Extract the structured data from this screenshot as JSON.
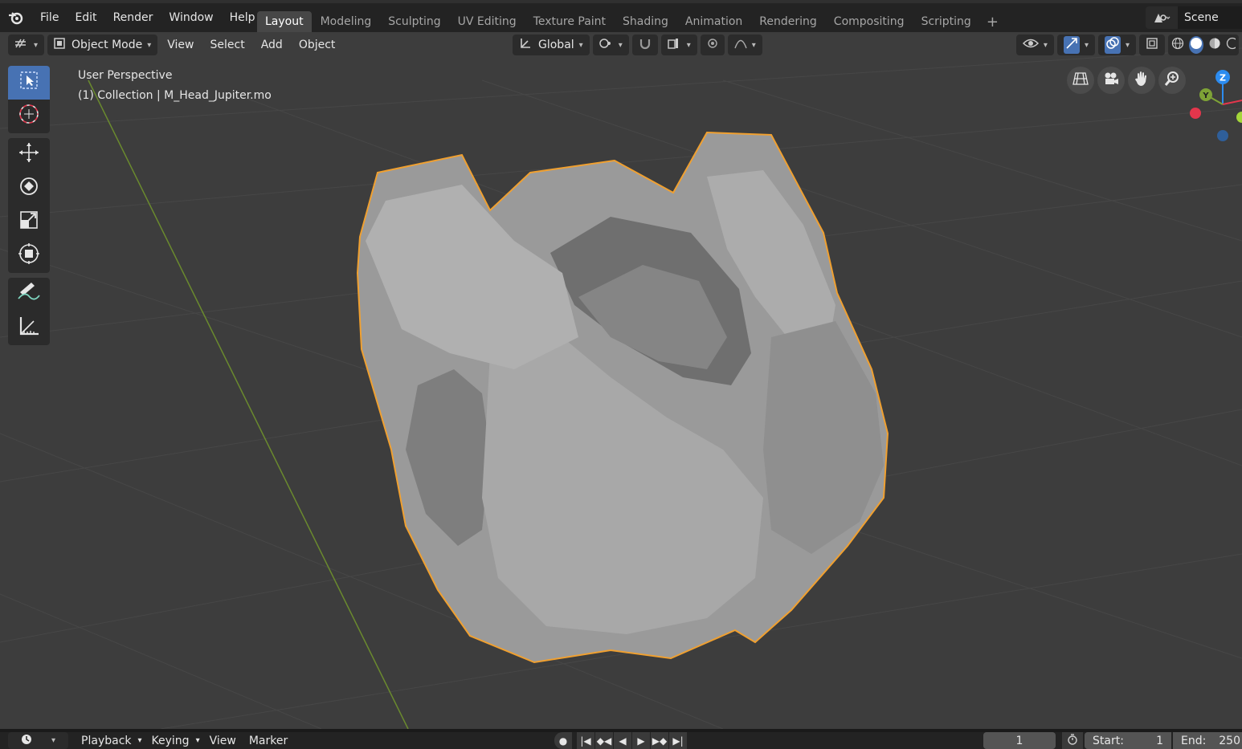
{
  "menubar": {
    "items": [
      "File",
      "Edit",
      "Render",
      "Window",
      "Help"
    ]
  },
  "workspaces": {
    "tabs": [
      "Layout",
      "Modeling",
      "Sculpting",
      "UV Editing",
      "Texture Paint",
      "Shading",
      "Animation",
      "Rendering",
      "Compositing",
      "Scripting"
    ],
    "active": "Layout",
    "add_label": "+"
  },
  "scene": {
    "name": "Scene"
  },
  "viewport_header": {
    "mode": "Object Mode",
    "menus": [
      "View",
      "Select",
      "Add",
      "Object"
    ],
    "orientation": "Global"
  },
  "viewport_overlay": {
    "line1": "User Perspective",
    "line2": "(1) Collection | M_Head_Jupiter.mo"
  },
  "gizmo": {
    "z": "Z",
    "y": "Y"
  },
  "timeline": {
    "menus": [
      "Playback",
      "Keying",
      "View",
      "Marker"
    ],
    "current_frame": "1",
    "start_label": "Start:",
    "start_value": "1",
    "end_label": "End:",
    "end_value": "250"
  },
  "colors": {
    "accent": "#4772b3",
    "selection_outline": "#f0a030",
    "x_axis": "#e4364c",
    "y_axis": "#7ea336",
    "z_axis": "#2c8cf0"
  }
}
